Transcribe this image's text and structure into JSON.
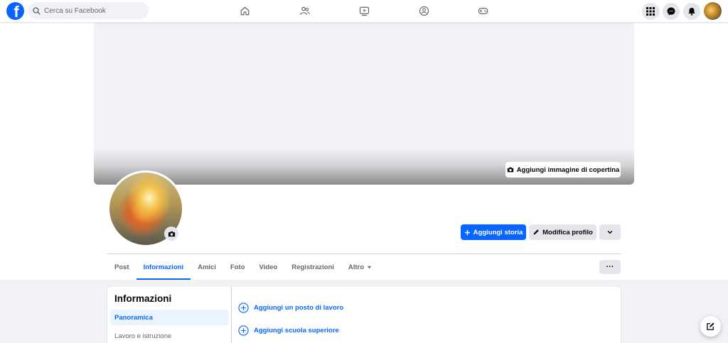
{
  "topbar": {
    "logo": "f",
    "search_placeholder": "Cerca su Facebook",
    "nav_icons": [
      "home-icon",
      "friends-icon",
      "video-icon",
      "groups-icon",
      "gaming-icon"
    ],
    "right_icons": [
      "menu-grid-icon",
      "messenger-icon",
      "notifications-icon"
    ]
  },
  "cover": {
    "add_cover_label": "Aggiungi immagine di copertina"
  },
  "actions": {
    "add_story_label": "Aggiungi storia",
    "edit_profile_label": "Modifica profilo"
  },
  "tabs": [
    {
      "label": "Post",
      "active": false
    },
    {
      "label": "Informazioni",
      "active": true
    },
    {
      "label": "Amici",
      "active": false
    },
    {
      "label": "Foto",
      "active": false
    },
    {
      "label": "Video",
      "active": false
    },
    {
      "label": "Registrazioni",
      "active": false
    },
    {
      "label": "Altro",
      "active": false
    }
  ],
  "more_label": "···",
  "info": {
    "title": "Informazioni",
    "sidebar": [
      {
        "label": "Panoramica",
        "active": true
      },
      {
        "label": "Lavoro e istruzione",
        "active": false
      }
    ],
    "add_items": [
      {
        "label": "Aggiungi un posto di lavoro"
      },
      {
        "label": "Aggiungi scuola superiore"
      }
    ]
  },
  "colors": {
    "accent": "#0866ff",
    "background": "#f0f2f5",
    "button_gray": "#e4e6eb",
    "text_secondary": "#65676b"
  }
}
